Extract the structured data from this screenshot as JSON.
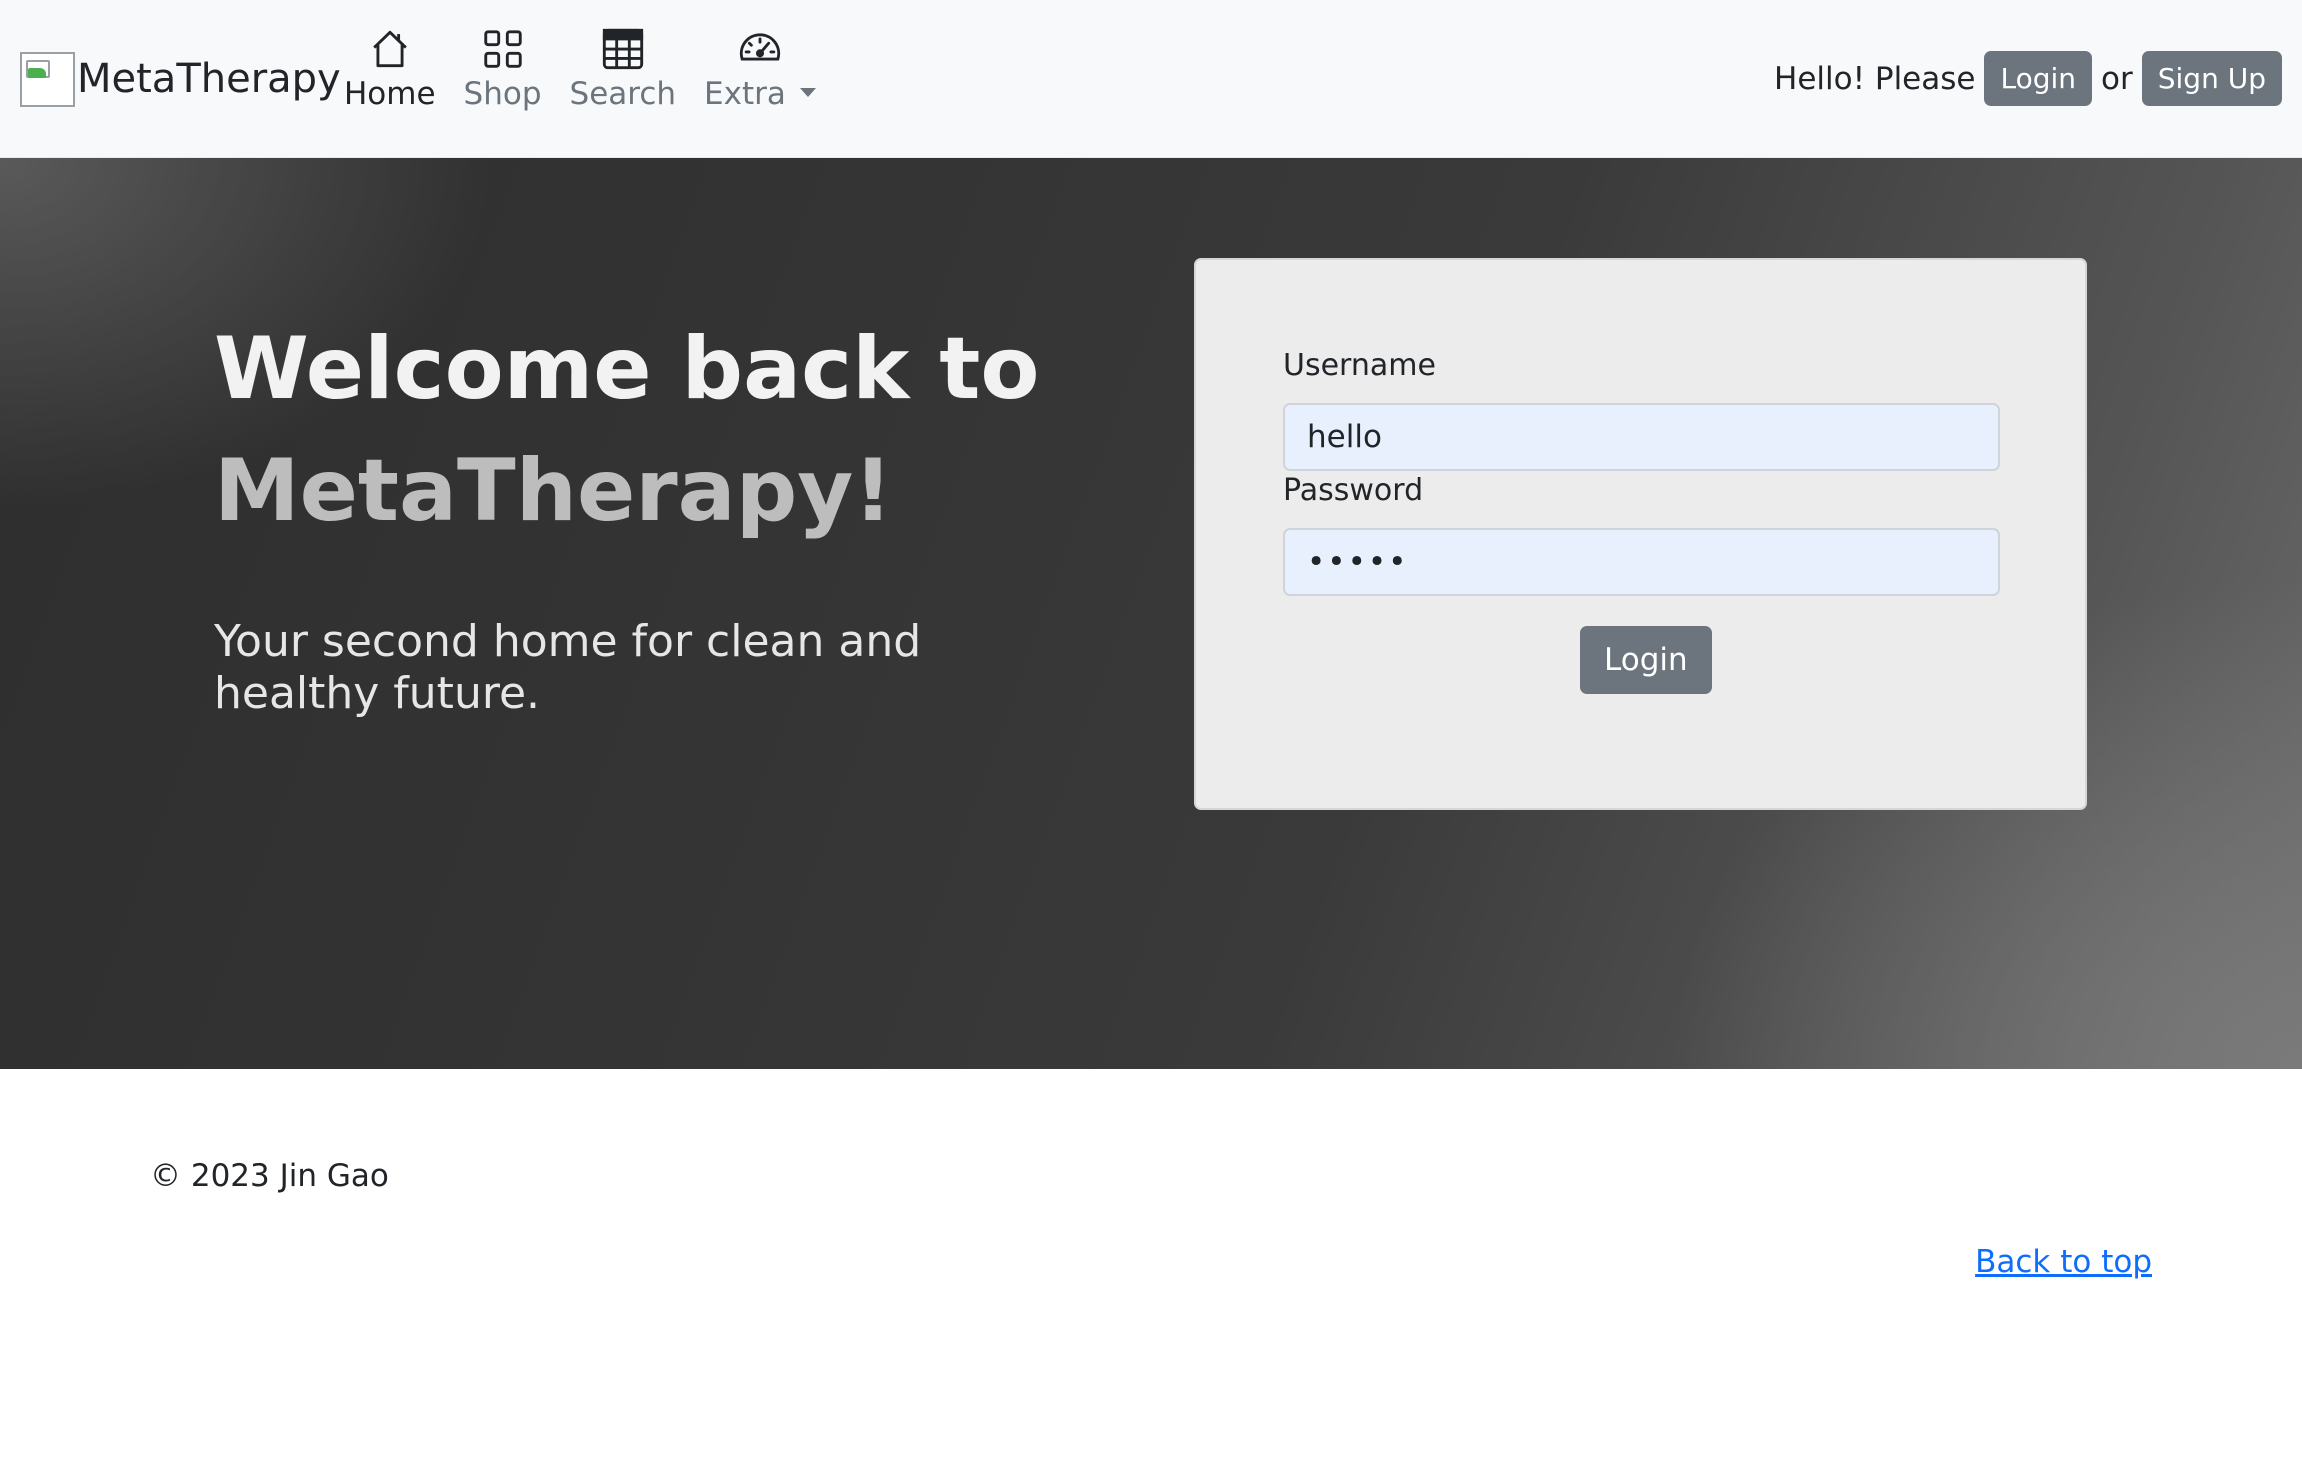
{
  "header": {
    "brand": "MetaTherapy",
    "nav": [
      {
        "label": "Home",
        "icon": "house-icon",
        "active": true
      },
      {
        "label": "Shop",
        "icon": "grid-icon",
        "active": false
      },
      {
        "label": "Search",
        "icon": "table-icon",
        "active": false
      },
      {
        "label": "Extra",
        "icon": "speedometer-icon",
        "active": false,
        "dropdown": true
      }
    ],
    "greeting": "Hello! Please",
    "login_label": "Login",
    "or_text": "or",
    "signup_label": "Sign Up"
  },
  "hero": {
    "title_line1": "Welcome back to",
    "title_line2": "MetaTherapy!",
    "subtitle": "Your second home for clean and healthy future."
  },
  "login_form": {
    "username_label": "Username",
    "username_value": "hello",
    "password_label": "Password",
    "password_value": "•••••",
    "submit_label": "Login"
  },
  "footer": {
    "copyright": "© 2023 Jin Gao",
    "back_to_top": "Back to top"
  },
  "colors": {
    "navbar_bg": "#f8f9fa",
    "button_secondary": "#6c757d",
    "input_autofill_bg": "#e8f0fe",
    "link": "#0d6efd"
  }
}
